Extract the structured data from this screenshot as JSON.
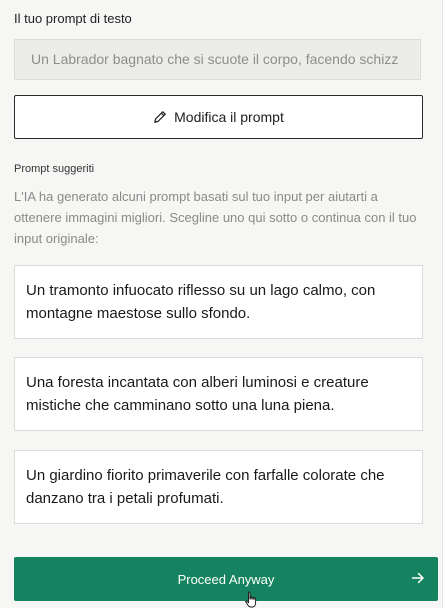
{
  "prompt_section": {
    "label": "Il tuo prompt di testo",
    "input_value": "Un Labrador bagnato che si scuote il corpo, facendo schizz",
    "edit_button_label": "Modifica il prompt",
    "edit_icon": "pencil-icon"
  },
  "suggestions": {
    "title": "Prompt suggeriti",
    "description": "L'IA ha generato alcuni prompt basati sul tuo input per aiutarti a ottenere immagini migliori. Scegline uno qui sotto o continua con il tuo input originale:",
    "items": [
      {
        "text": "Un tramonto infuocato riflesso su un lago calmo, con montagne maestose sullo sfondo."
      },
      {
        "text": "Una foresta incantata con alberi luminosi e creature mistiche che camminano sotto una luna piena."
      },
      {
        "text": "Un giardino fiorito primaverile con farfalle colorate che danzano tra i petali profumati."
      }
    ]
  },
  "proceed": {
    "label": "Proceed Anyway",
    "icon": "arrow-right-icon"
  },
  "colors": {
    "accent": "#15835f",
    "background": "#f6f6f5",
    "input_background": "#ececeb"
  }
}
